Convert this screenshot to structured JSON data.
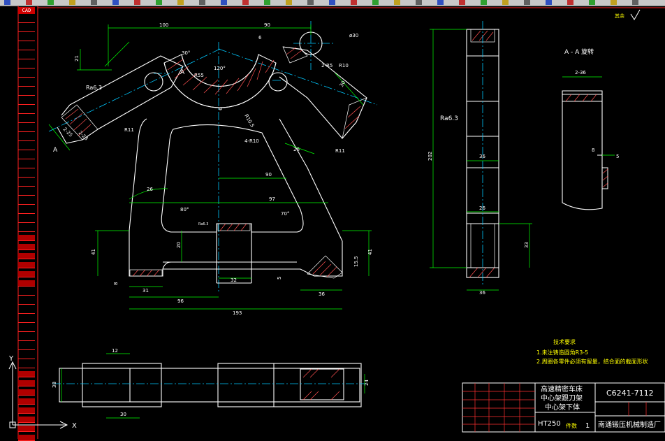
{
  "window": {
    "toolbar_icons": 30,
    "colors": {
      "background": "#000000",
      "outline": "#ffffff",
      "dimension": "#00ff00",
      "center": "#00c8ff",
      "hatch": "#ff4040",
      "title_yellow": "#ffff00",
      "toolbar": "#c8c8c8",
      "frame_red": "#ff0000"
    }
  },
  "layer_stack": {
    "cad_label": "CAD",
    "rows": [
      "",
      "",
      "",
      "",
      "",
      "",
      "",
      "",
      "",
      "",
      "",
      "",
      "",
      "",
      "",
      "",
      "",
      "",
      "",
      "",
      "",
      "",
      "",
      "",
      "",
      "",
      "",
      "",
      "",
      "",
      "",
      "",
      "",
      "",
      "",
      "",
      "",
      "",
      "",
      "",
      "",
      "",
      "",
      "",
      "",
      "",
      ""
    ]
  },
  "ucs": {
    "x_label": "X",
    "y_label": "Y"
  },
  "drawing": {
    "corner_note": "其余",
    "front_dims": {
      "d100": "100",
      "d90_top": "90",
      "d6_top": "6",
      "dia30": "ø30",
      "d21": "21",
      "a30": "30°",
      "a120": "120°",
      "r55": "R55",
      "r10_right": "R10",
      "r5": "2-R5",
      "r105": "R10.5",
      "d25": "2-25",
      "d23": "2-23",
      "d30r": "30",
      "ra63": "Ra6.3",
      "A_left": "A",
      "A_mid": "A",
      "r11": "R11",
      "r10_left": "4-R10",
      "d26_right": "26",
      "r11_right": "R11",
      "d90_mid": "90",
      "d97": "97",
      "d26_left": "26",
      "a80": "80°",
      "a70": "70°",
      "ra_small": "Ra6.3",
      "d20": "20",
      "d41_left": "41",
      "d8_left": "8",
      "d31": "31",
      "d32": "32",
      "d5": "5",
      "d36": "36",
      "d15": "15.5",
      "d41_right": "41",
      "d96": "96",
      "d193": "193",
      "d6_center": "6"
    },
    "side_dims": {
      "ra63": "Ra6.3",
      "h202": "202",
      "w36a": "36",
      "w26": "26",
      "h33": "33",
      "w36b": "36"
    },
    "section": {
      "title": "A - A 旋转",
      "w236": "2-36",
      "d8": "8",
      "d5": "5"
    },
    "bottom_dims": {
      "d12": "12",
      "d30": "30",
      "d38": "38",
      "d24": "24"
    },
    "tech": {
      "title": "技术要求",
      "line1": "1.未注铸造圆角R3-5",
      "line2": "2.周圈各零件必须有留量，结合面的截面形状"
    },
    "title_block": {
      "name_lines": [
        "高速精密车床",
        "中心架跟刀架",
        "中心架下体"
      ],
      "code": "C6241-7112",
      "material": "HT250",
      "qty_label": "件数",
      "qty": "1",
      "company": "南通锻压机械制造厂"
    }
  }
}
